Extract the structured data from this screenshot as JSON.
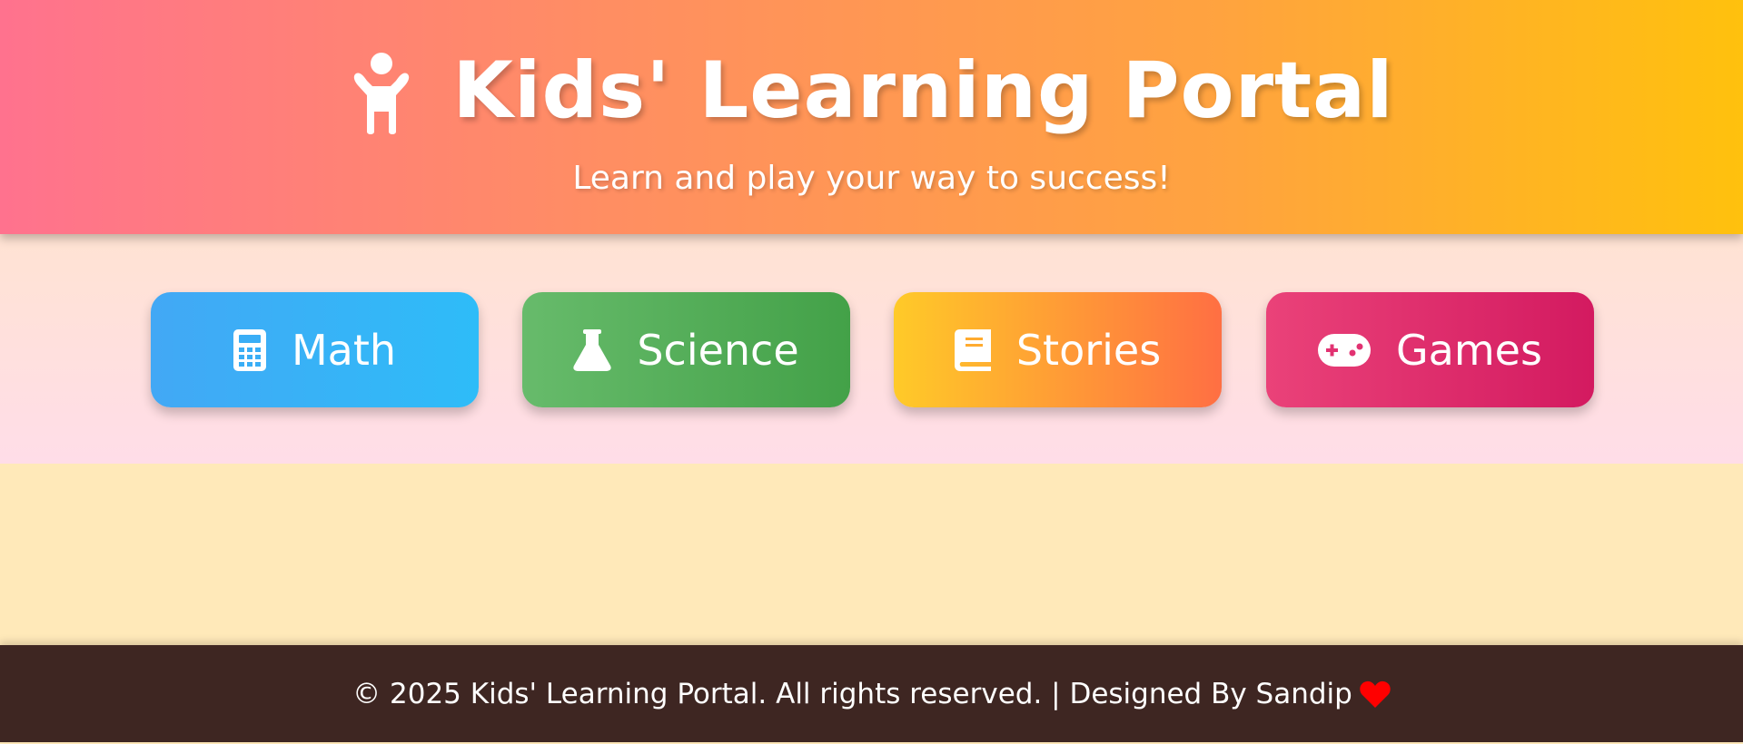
{
  "header": {
    "title": "Kids' Learning Portal",
    "subtitle": "Learn and play your way to success!",
    "icon": "child-icon"
  },
  "nav": {
    "items": [
      {
        "label": "Math",
        "icon": "calculator-icon",
        "color": "#42a8f5"
      },
      {
        "label": "Science",
        "icon": "flask-icon",
        "color": "#4caf50"
      },
      {
        "label": "Stories",
        "icon": "book-icon",
        "color": "#ff9d34"
      },
      {
        "label": "Games",
        "icon": "gamepad-icon",
        "color": "#e23272"
      }
    ]
  },
  "footer": {
    "text": "© 2025 Kids' Learning Portal. All rights reserved. | Designed By Sandip",
    "icon": "heart-icon",
    "icon_color": "#ff0000"
  },
  "colors": {
    "header_start": "#ff728e",
    "header_end": "#ffc10d",
    "footer_bg": "#3e2622",
    "content_bg": "#ffe9b9"
  }
}
